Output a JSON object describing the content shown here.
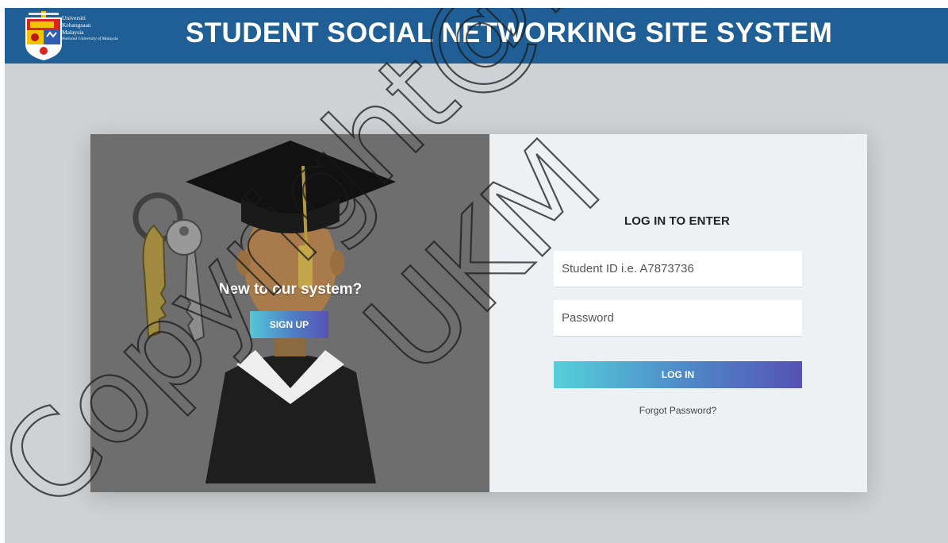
{
  "header": {
    "title": "STUDENT SOCIAL NETWORKING SITE SYSTEM",
    "logo": {
      "line1": "Universiti",
      "line2": "Kebangsaan",
      "line3": "Malaysia",
      "line4": "National University of Malaysia"
    }
  },
  "left_panel": {
    "heading": "New to our system?",
    "signup_label": "SIGN UP"
  },
  "login": {
    "title": "LOG IN TO ENTER",
    "student_id_placeholder": "Student ID i.e. A7873736",
    "password_placeholder": "Password",
    "button_label": "LOG IN",
    "forgot_label": "Forgot Password?"
  },
  "colors": {
    "header_bg": "#1f5f96",
    "page_bg": "#cfd2d4",
    "panel_bg": "#eef1f3",
    "gradient_start": "#53c7d8",
    "gradient_end": "#5753b6"
  },
  "watermark": {
    "text1": "Copyright@FTSM",
    "text2": "UKM"
  }
}
